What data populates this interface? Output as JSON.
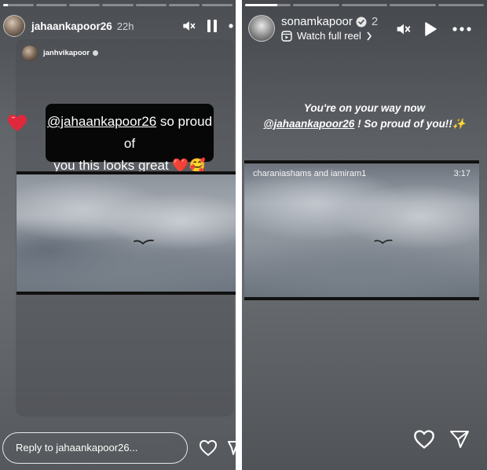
{
  "left_story": {
    "progress": [
      1,
      0,
      0,
      0,
      0,
      0,
      0
    ],
    "progress_current_fill": 0.15,
    "username": "jahaankapoor26",
    "timestamp": "22h",
    "shared_post": {
      "username": "janhvikapoor",
      "caption_mention": "@jahaankapoor26",
      "caption_line1_rest": " so proud of",
      "caption_line2": "you this looks great ",
      "caption_emoji": "❤️🥰",
      "heart_sticker": "heart-icon"
    },
    "reply_placeholder": "Reply to jahaankapoor26...",
    "icons": [
      "mute-icon",
      "pause-icon",
      "more-icon",
      "heart-icon",
      "send-icon"
    ]
  },
  "right_story": {
    "progress": [
      1,
      0,
      0,
      0,
      0
    ],
    "progress_current_fill": 0.7,
    "username": "sonamkapoor",
    "timestamp": "2",
    "watch_full_reel": "Watch full reel",
    "caption_line1": "You're on your way now",
    "caption_mention": "@jahaankapoor26",
    "caption_line2_rest": " ! So proud of you!!",
    "caption_emoji": "✨",
    "reel_credit": "charaniashams and iamiram1",
    "reel_duration": "3:17",
    "icons": [
      "mute-icon",
      "play-icon",
      "more-icon",
      "heart-icon",
      "send-icon"
    ]
  },
  "colors": {
    "text": "#ffffff",
    "caption_box": "#000000",
    "heart": "#e0283c"
  }
}
